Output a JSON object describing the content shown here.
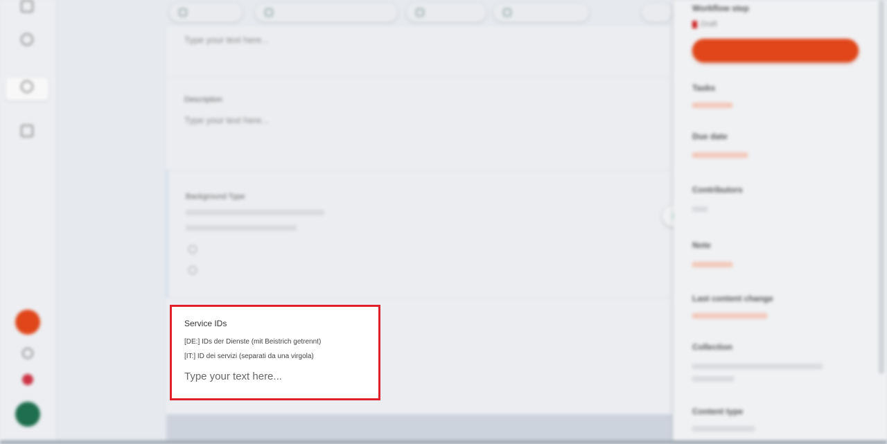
{
  "sidebar": {
    "items": [
      {
        "label": "",
        "icon": "home-icon"
      },
      {
        "label": "",
        "icon": "globe-icon"
      },
      {
        "label": "",
        "icon": "globe-icon"
      },
      {
        "label": "",
        "icon": "briefcase-icon"
      }
    ]
  },
  "topbar": {
    "tabs": [
      {
        "label": "",
        "icon": "grid-icon"
      },
      {
        "label": "",
        "icon": "list-icon"
      },
      {
        "label": "",
        "icon": "filter-icon"
      },
      {
        "label": "",
        "icon": "calendar-icon"
      }
    ]
  },
  "form": {
    "top_placeholder": "Type your text here...",
    "description": {
      "label": "Description",
      "placeholder": "Type your text here..."
    },
    "background_type": {
      "label": "Background Type",
      "options": [
        "",
        ""
      ]
    }
  },
  "service_ids": {
    "label": "Service IDs",
    "hint_de": "[DE:] IDs der Dienste (mit Beistrich getrennt)",
    "hint_it": "[IT:] ID dei servizi (separati da una virgola)",
    "placeholder": "Type your text here...",
    "value": ""
  },
  "right_panel": {
    "workflow_step": {
      "label": "Workflow step",
      "value": "Draft"
    },
    "tasks_label": "Tasks",
    "due_date_label": "Due date",
    "contributors_label": "Contributors",
    "note_label": "Note",
    "last_content_change_label": "Last content change",
    "collection_label": "Collection",
    "content_type_label": "Content type"
  },
  "colors": {
    "accent": "#e0461a",
    "highlight_border": "#e0212b",
    "avatar": "#1f6e4f"
  }
}
